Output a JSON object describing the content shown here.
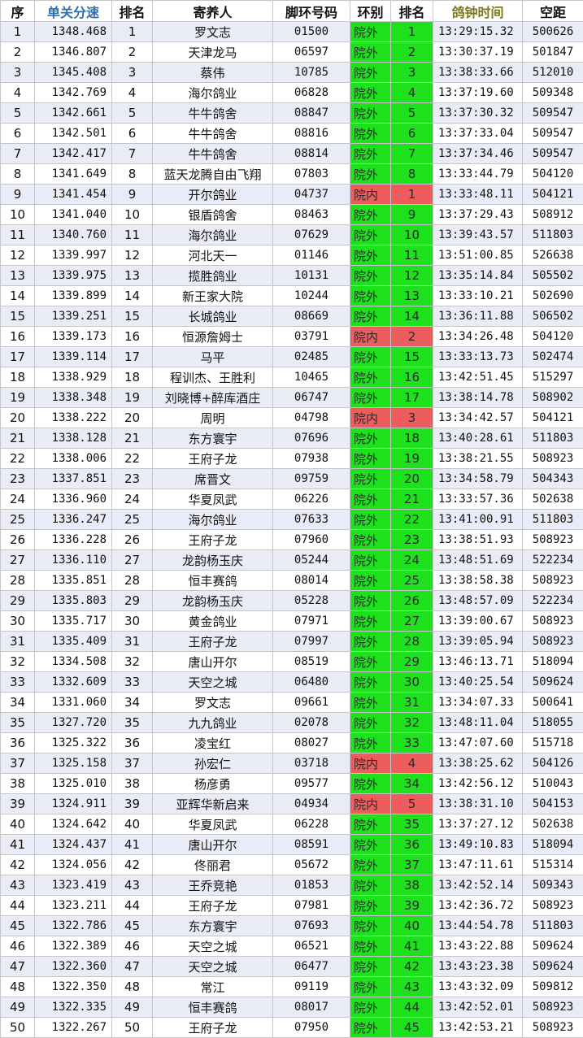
{
  "headers": {
    "seq": "序",
    "speed": "单关分速",
    "rank": "排名",
    "owner": "寄养人",
    "ring_no": "脚环号码",
    "ring_type": "环别",
    "rank2": "排名",
    "clock_time": "鸽钟时间",
    "distance": "空距"
  },
  "colors": {
    "outer_green": "#1ee11e",
    "inner_red": "#ee5d5d",
    "zebra_blue": "#e9ecf7",
    "header_blue_text": "#2f6fb0",
    "header_olive_text": "#7a7a1a"
  },
  "rows": [
    {
      "seq": "1",
      "speed": "1348.468",
      "rank": "1",
      "owner": "罗文志",
      "ring_no": "01500",
      "ring_type": "院外",
      "rank2": "1",
      "time": "13:29:15.32",
      "dist": "500626"
    },
    {
      "seq": "2",
      "speed": "1346.807",
      "rank": "2",
      "owner": "天津龙马",
      "ring_no": "06597",
      "ring_type": "院外",
      "rank2": "2",
      "time": "13:30:37.19",
      "dist": "501847"
    },
    {
      "seq": "3",
      "speed": "1345.408",
      "rank": "3",
      "owner": "蔡伟",
      "ring_no": "10785",
      "ring_type": "院外",
      "rank2": "3",
      "time": "13:38:33.66",
      "dist": "512010"
    },
    {
      "seq": "4",
      "speed": "1342.769",
      "rank": "4",
      "owner": "海尔鸽业",
      "ring_no": "06828",
      "ring_type": "院外",
      "rank2": "4",
      "time": "13:37:19.60",
      "dist": "509348"
    },
    {
      "seq": "5",
      "speed": "1342.661",
      "rank": "5",
      "owner": "牛牛鸽舍",
      "ring_no": "08847",
      "ring_type": "院外",
      "rank2": "5",
      "time": "13:37:30.32",
      "dist": "509547"
    },
    {
      "seq": "6",
      "speed": "1342.501",
      "rank": "6",
      "owner": "牛牛鸽舍",
      "ring_no": "08816",
      "ring_type": "院外",
      "rank2": "6",
      "time": "13:37:33.04",
      "dist": "509547"
    },
    {
      "seq": "7",
      "speed": "1342.417",
      "rank": "7",
      "owner": "牛牛鸽舍",
      "ring_no": "08814",
      "ring_type": "院外",
      "rank2": "7",
      "time": "13:37:34.46",
      "dist": "509547"
    },
    {
      "seq": "8",
      "speed": "1341.649",
      "rank": "8",
      "owner": "蓝天龙腾自由飞翔",
      "ring_no": "07803",
      "ring_type": "院外",
      "rank2": "8",
      "time": "13:33:44.79",
      "dist": "504120"
    },
    {
      "seq": "9",
      "speed": "1341.454",
      "rank": "9",
      "owner": "开尔鸽业",
      "ring_no": "04737",
      "ring_type": "院内",
      "rank2": "1",
      "time": "13:33:48.11",
      "dist": "504121"
    },
    {
      "seq": "10",
      "speed": "1341.040",
      "rank": "10",
      "owner": "银盾鸽舍",
      "ring_no": "08463",
      "ring_type": "院外",
      "rank2": "9",
      "time": "13:37:29.43",
      "dist": "508912"
    },
    {
      "seq": "11",
      "speed": "1340.760",
      "rank": "11",
      "owner": "海尔鸽业",
      "ring_no": "07629",
      "ring_type": "院外",
      "rank2": "10",
      "time": "13:39:43.57",
      "dist": "511803"
    },
    {
      "seq": "12",
      "speed": "1339.997",
      "rank": "12",
      "owner": "河北天一",
      "ring_no": "01146",
      "ring_type": "院外",
      "rank2": "11",
      "time": "13:51:00.85",
      "dist": "526638"
    },
    {
      "seq": "13",
      "speed": "1339.975",
      "rank": "13",
      "owner": "揽胜鸽业",
      "ring_no": "10131",
      "ring_type": "院外",
      "rank2": "12",
      "time": "13:35:14.84",
      "dist": "505502"
    },
    {
      "seq": "14",
      "speed": "1339.899",
      "rank": "14",
      "owner": "新王家大院",
      "ring_no": "10244",
      "ring_type": "院外",
      "rank2": "13",
      "time": "13:33:10.21",
      "dist": "502690"
    },
    {
      "seq": "15",
      "speed": "1339.251",
      "rank": "15",
      "owner": "长城鸽业",
      "ring_no": "08669",
      "ring_type": "院外",
      "rank2": "14",
      "time": "13:36:11.88",
      "dist": "506502"
    },
    {
      "seq": "16",
      "speed": "1339.173",
      "rank": "16",
      "owner": "恒源詹姆士",
      "ring_no": "03791",
      "ring_type": "院内",
      "rank2": "2",
      "time": "13:34:26.48",
      "dist": "504120"
    },
    {
      "seq": "17",
      "speed": "1339.114",
      "rank": "17",
      "owner": "马平",
      "ring_no": "02485",
      "ring_type": "院外",
      "rank2": "15",
      "time": "13:33:13.73",
      "dist": "502474"
    },
    {
      "seq": "18",
      "speed": "1338.929",
      "rank": "18",
      "owner": "程训杰、王胜利",
      "ring_no": "10465",
      "ring_type": "院外",
      "rank2": "16",
      "time": "13:42:51.45",
      "dist": "515297"
    },
    {
      "seq": "19",
      "speed": "1338.348",
      "rank": "19",
      "owner": "刘晓博+醉库酒庄",
      "ring_no": "06747",
      "ring_type": "院外",
      "rank2": "17",
      "time": "13:38:14.78",
      "dist": "508902"
    },
    {
      "seq": "20",
      "speed": "1338.222",
      "rank": "20",
      "owner": "周明",
      "ring_no": "04798",
      "ring_type": "院内",
      "rank2": "3",
      "time": "13:34:42.57",
      "dist": "504121"
    },
    {
      "seq": "21",
      "speed": "1338.128",
      "rank": "21",
      "owner": "东方寰宇",
      "ring_no": "07696",
      "ring_type": "院外",
      "rank2": "18",
      "time": "13:40:28.61",
      "dist": "511803"
    },
    {
      "seq": "22",
      "speed": "1338.006",
      "rank": "22",
      "owner": "王府子龙",
      "ring_no": "07938",
      "ring_type": "院外",
      "rank2": "19",
      "time": "13:38:21.55",
      "dist": "508923"
    },
    {
      "seq": "23",
      "speed": "1337.851",
      "rank": "23",
      "owner": "席晋文",
      "ring_no": "09759",
      "ring_type": "院外",
      "rank2": "20",
      "time": "13:34:58.79",
      "dist": "504343"
    },
    {
      "seq": "24",
      "speed": "1336.960",
      "rank": "24",
      "owner": "华夏凤武",
      "ring_no": "06226",
      "ring_type": "院外",
      "rank2": "21",
      "time": "13:33:57.36",
      "dist": "502638"
    },
    {
      "seq": "25",
      "speed": "1336.247",
      "rank": "25",
      "owner": "海尔鸽业",
      "ring_no": "07633",
      "ring_type": "院外",
      "rank2": "22",
      "time": "13:41:00.91",
      "dist": "511803"
    },
    {
      "seq": "26",
      "speed": "1336.228",
      "rank": "26",
      "owner": "王府子龙",
      "ring_no": "07960",
      "ring_type": "院外",
      "rank2": "23",
      "time": "13:38:51.93",
      "dist": "508923"
    },
    {
      "seq": "27",
      "speed": "1336.110",
      "rank": "27",
      "owner": "龙韵杨玉庆",
      "ring_no": "05244",
      "ring_type": "院外",
      "rank2": "24",
      "time": "13:48:51.69",
      "dist": "522234"
    },
    {
      "seq": "28",
      "speed": "1335.851",
      "rank": "28",
      "owner": "恒丰赛鸽",
      "ring_no": "08014",
      "ring_type": "院外",
      "rank2": "25",
      "time": "13:38:58.38",
      "dist": "508923"
    },
    {
      "seq": "29",
      "speed": "1335.803",
      "rank": "29",
      "owner": "龙韵杨玉庆",
      "ring_no": "05228",
      "ring_type": "院外",
      "rank2": "26",
      "time": "13:48:57.09",
      "dist": "522234"
    },
    {
      "seq": "30",
      "speed": "1335.717",
      "rank": "30",
      "owner": "黄金鸽业",
      "ring_no": "07971",
      "ring_type": "院外",
      "rank2": "27",
      "time": "13:39:00.67",
      "dist": "508923"
    },
    {
      "seq": "31",
      "speed": "1335.409",
      "rank": "31",
      "owner": "王府子龙",
      "ring_no": "07997",
      "ring_type": "院外",
      "rank2": "28",
      "time": "13:39:05.94",
      "dist": "508923"
    },
    {
      "seq": "32",
      "speed": "1334.508",
      "rank": "32",
      "owner": "唐山开尔",
      "ring_no": "08519",
      "ring_type": "院外",
      "rank2": "29",
      "time": "13:46:13.71",
      "dist": "518094"
    },
    {
      "seq": "33",
      "speed": "1332.609",
      "rank": "33",
      "owner": "天空之城",
      "ring_no": "06480",
      "ring_type": "院外",
      "rank2": "30",
      "time": "13:40:25.54",
      "dist": "509624"
    },
    {
      "seq": "34",
      "speed": "1331.060",
      "rank": "34",
      "owner": "罗文志",
      "ring_no": "09661",
      "ring_type": "院外",
      "rank2": "31",
      "time": "13:34:07.33",
      "dist": "500641"
    },
    {
      "seq": "35",
      "speed": "1327.720",
      "rank": "35",
      "owner": "九九鸽业",
      "ring_no": "02078",
      "ring_type": "院外",
      "rank2": "32",
      "time": "13:48:11.04",
      "dist": "518055"
    },
    {
      "seq": "36",
      "speed": "1325.322",
      "rank": "36",
      "owner": "凌宝红",
      "ring_no": "08027",
      "ring_type": "院外",
      "rank2": "33",
      "time": "13:47:07.60",
      "dist": "515718"
    },
    {
      "seq": "37",
      "speed": "1325.158",
      "rank": "37",
      "owner": "孙宏仁",
      "ring_no": "03718",
      "ring_type": "院内",
      "rank2": "4",
      "time": "13:38:25.62",
      "dist": "504126"
    },
    {
      "seq": "38",
      "speed": "1325.010",
      "rank": "38",
      "owner": "杨彦勇",
      "ring_no": "09577",
      "ring_type": "院外",
      "rank2": "34",
      "time": "13:42:56.12",
      "dist": "510043"
    },
    {
      "seq": "39",
      "speed": "1324.911",
      "rank": "39",
      "owner": "亚辉华新启来",
      "ring_no": "04934",
      "ring_type": "院内",
      "rank2": "5",
      "time": "13:38:31.10",
      "dist": "504153"
    },
    {
      "seq": "40",
      "speed": "1324.642",
      "rank": "40",
      "owner": "华夏凤武",
      "ring_no": "06228",
      "ring_type": "院外",
      "rank2": "35",
      "time": "13:37:27.12",
      "dist": "502638"
    },
    {
      "seq": "41",
      "speed": "1324.437",
      "rank": "41",
      "owner": "唐山开尔",
      "ring_no": "08591",
      "ring_type": "院外",
      "rank2": "36",
      "time": "13:49:10.83",
      "dist": "518094"
    },
    {
      "seq": "42",
      "speed": "1324.056",
      "rank": "42",
      "owner": "佟丽君",
      "ring_no": "05672",
      "ring_type": "院外",
      "rank2": "37",
      "time": "13:47:11.61",
      "dist": "515314"
    },
    {
      "seq": "43",
      "speed": "1323.419",
      "rank": "43",
      "owner": "王乔竞艳",
      "ring_no": "01853",
      "ring_type": "院外",
      "rank2": "38",
      "time": "13:42:52.14",
      "dist": "509343"
    },
    {
      "seq": "44",
      "speed": "1323.211",
      "rank": "44",
      "owner": "王府子龙",
      "ring_no": "07981",
      "ring_type": "院外",
      "rank2": "39",
      "time": "13:42:36.72",
      "dist": "508923"
    },
    {
      "seq": "45",
      "speed": "1322.786",
      "rank": "45",
      "owner": "东方寰宇",
      "ring_no": "07693",
      "ring_type": "院外",
      "rank2": "40",
      "time": "13:44:54.78",
      "dist": "511803"
    },
    {
      "seq": "46",
      "speed": "1322.389",
      "rank": "46",
      "owner": "天空之城",
      "ring_no": "06521",
      "ring_type": "院外",
      "rank2": "41",
      "time": "13:43:22.88",
      "dist": "509624"
    },
    {
      "seq": "47",
      "speed": "1322.360",
      "rank": "47",
      "owner": "天空之城",
      "ring_no": "06477",
      "ring_type": "院外",
      "rank2": "42",
      "time": "13:43:23.38",
      "dist": "509624"
    },
    {
      "seq": "48",
      "speed": "1322.350",
      "rank": "48",
      "owner": "常江",
      "ring_no": "09119",
      "ring_type": "院外",
      "rank2": "43",
      "time": "13:43:32.09",
      "dist": "509812"
    },
    {
      "seq": "49",
      "speed": "1322.335",
      "rank": "49",
      "owner": "恒丰赛鸽",
      "ring_no": "08017",
      "ring_type": "院外",
      "rank2": "44",
      "time": "13:42:52.01",
      "dist": "508923"
    },
    {
      "seq": "50",
      "speed": "1322.267",
      "rank": "50",
      "owner": "王府子龙",
      "ring_no": "07950",
      "ring_type": "院外",
      "rank2": "45",
      "time": "13:42:53.21",
      "dist": "508923"
    }
  ]
}
